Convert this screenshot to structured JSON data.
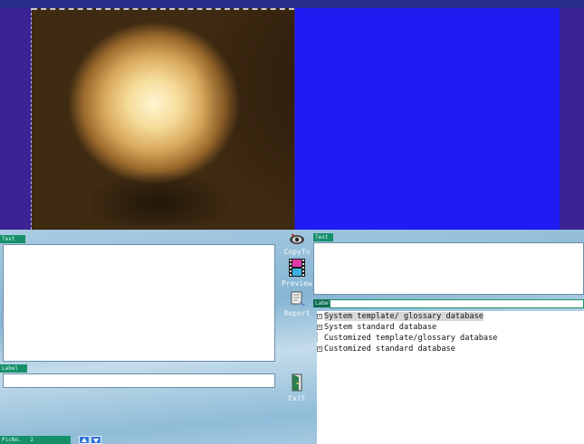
{
  "left_panel": {
    "text_label": "Text",
    "label_label": "Label",
    "picno_label": "PicNo.",
    "picno_value": "2"
  },
  "toolbar": {
    "copyto": "CopyTo",
    "preview": "Preview",
    "report": "Report",
    "exit": "Exit"
  },
  "right_panel": {
    "text_label": "Text",
    "label_label": "Label",
    "tree": [
      {
        "label": "System template/ glossary database",
        "expandable": true
      },
      {
        "label": "System standard database",
        "expandable": true
      },
      {
        "label": "Customized template/glossary database",
        "expandable": false
      },
      {
        "label": "Customized standard database",
        "expandable": true
      }
    ]
  },
  "colors": {
    "viewer_bg": "#3c2394",
    "blank_pane": "#1e1cf2",
    "label_tag": "#16906a",
    "panel_bg": "#a9cce2"
  },
  "icons": {
    "copyto": "eye-icon",
    "preview": "film-icon",
    "report": "report-icon",
    "exit": "exit-door-icon",
    "up": "arrow-up-icon",
    "down": "arrow-down-icon"
  }
}
